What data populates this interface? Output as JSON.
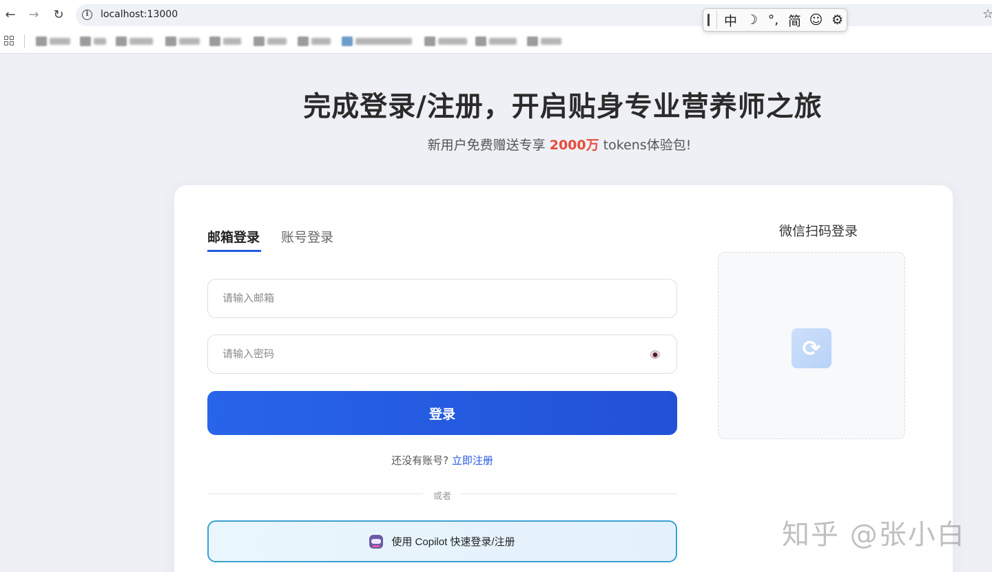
{
  "browser": {
    "url": "localhost:13000",
    "back_icon": "←",
    "forward_icon": "→",
    "reload_icon": "↻",
    "info_icon": "i",
    "star_icon": "☆"
  },
  "ime_toolbar": {
    "items": [
      "中",
      "☽",
      "°,",
      "简",
      "☺",
      "⚙"
    ]
  },
  "page": {
    "title": "完成登录/注册，开启贴身专业营养师之旅",
    "subtitle_pre": "新用户免费赠送专享",
    "subtitle_highlight": "2000万",
    "subtitle_post": "tokens体验包!"
  },
  "login": {
    "tabs": [
      {
        "label": "邮箱登录",
        "active": true
      },
      {
        "label": "账号登录",
        "active": false
      }
    ],
    "email_placeholder": "请输入邮箱",
    "password_placeholder": "请输入密码",
    "submit_label": "登录",
    "no_account_text": "还没有账号?",
    "register_link": "立即注册",
    "divider_text": "或者",
    "copilot_label": "使用 Copilot 快速登录/注册"
  },
  "wechat": {
    "title": "微信扫码登录",
    "refresh_icon": "⟳"
  },
  "watermark": "知乎 @张小白",
  "colors": {
    "accent": "#2358e0",
    "highlight": "#e84a3c",
    "copilot_border": "#3a9fd1"
  }
}
